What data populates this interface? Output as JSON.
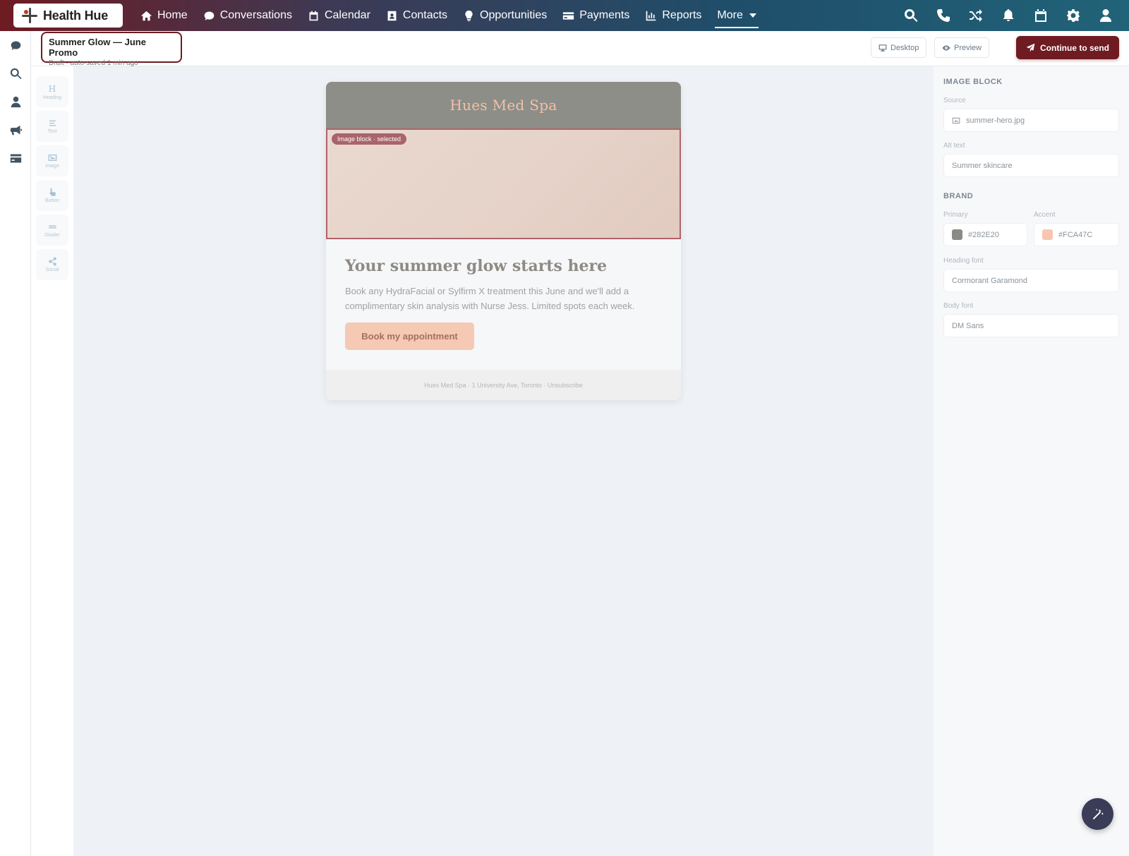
{
  "app": {
    "logo_text": "Health Hue"
  },
  "nav": {
    "items": [
      {
        "label": "Home",
        "icon": "home-icon"
      },
      {
        "label": "Conversations",
        "icon": "chat-icon"
      },
      {
        "label": "Calendar",
        "icon": "calendar-icon"
      },
      {
        "label": "Contacts",
        "icon": "contact-card-icon"
      },
      {
        "label": "Opportunities",
        "icon": "lightbulb-icon"
      },
      {
        "label": "Payments",
        "icon": "credit-card-icon"
      },
      {
        "label": "Reports",
        "icon": "bar-chart-icon"
      },
      {
        "label": "More",
        "icon": "chevron-down-icon",
        "active": true
      }
    ],
    "right_icons": [
      "search-icon",
      "phone-icon",
      "shuffle-icon",
      "bell-icon",
      "calendar-icon",
      "gear-icon",
      "user-icon"
    ]
  },
  "left_rail": {
    "icons": [
      "chat-icon",
      "search-icon",
      "user-icon",
      "megaphone-icon",
      "credit-card-icon"
    ]
  },
  "palette": {
    "items": [
      {
        "label": "Heading",
        "icon": "heading-icon"
      },
      {
        "label": "Text",
        "icon": "text-lines-icon"
      },
      {
        "label": "Image",
        "icon": "image-icon"
      },
      {
        "label": "Button",
        "icon": "pointer-icon"
      },
      {
        "label": "Divider",
        "icon": "divider-icon"
      },
      {
        "label": "Social",
        "icon": "share-icon"
      }
    ]
  },
  "editor": {
    "doc_title": "Summer Glow — June Promo",
    "doc_status": "Draft · auto-saved 1 min ago",
    "desktop_label": "Desktop",
    "preview_label": "Preview",
    "send_label": "Continue to send"
  },
  "email": {
    "brand": "Hues Med Spa",
    "selected_badge": "Image block · selected",
    "heading": "Your summer glow starts here",
    "body": "Book any HydraFacial or Sylfirm X treatment this June and we'll add a complimentary skin analysis with Nurse Jess. Limited spots each week.",
    "cta_label": "Book my appointment",
    "footer": "Hues Med Spa · 1 University Ave, Toronto · Unsubscribe"
  },
  "panel": {
    "image_block_title": "IMAGE BLOCK",
    "source_label": "Source",
    "source_value": "summer-hero.jpg",
    "alt_label": "Alt text",
    "alt_value": "Summer skincare",
    "brand_title": "BRAND",
    "primary_label": "Primary",
    "primary_value": "#282E20",
    "primary_swatch": "#8a8a87",
    "accent_label": "Accent",
    "accent_value": "#FCA47C",
    "accent_swatch": "#f7c6b0",
    "heading_font_label": "Heading font",
    "heading_font_value": "Cormorant Garamond",
    "body_font_label": "Body font",
    "body_font_value": "DM Sans"
  },
  "colors": {
    "accent_dark": "#6e1b22",
    "selection": "#b2626a"
  }
}
